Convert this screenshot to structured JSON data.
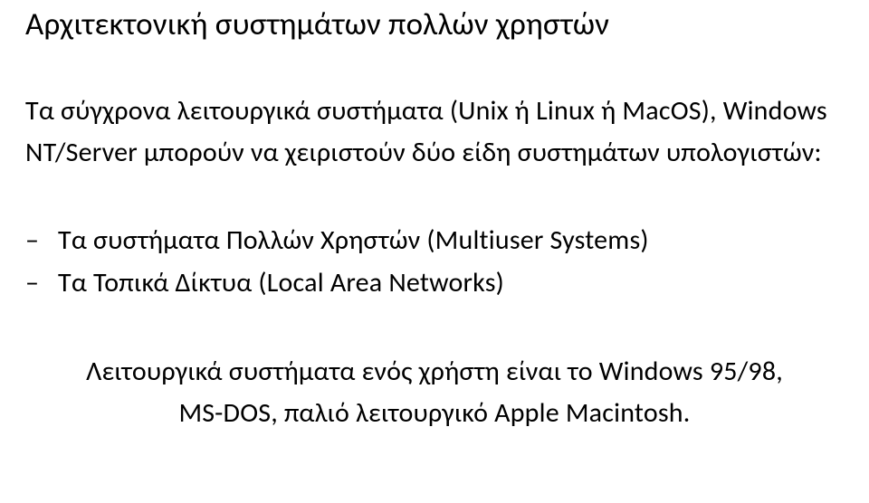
{
  "title": "Αρχιτεκτονική συστημάτων πολλών χρηστών",
  "intro": "Τα σύγχρονα λειτουργικά συστήματα (Unix ή Linux ή MacOS), Windows NT/Server μπορούν να χειριστούν δύο είδη συστημάτων υπολογιστών:",
  "items": [
    "Τα συστήματα Πολλών Χρηστών (Multiuser Systems)",
    "Τα Τοπικά Δίκτυα (Local Area Networks)"
  ],
  "footer": "Λειτουργικά συστήματα ενός χρήστη είναι το Windows 95/98, MS-DOS, παλιό λειτουργικό Apple Macintosh."
}
